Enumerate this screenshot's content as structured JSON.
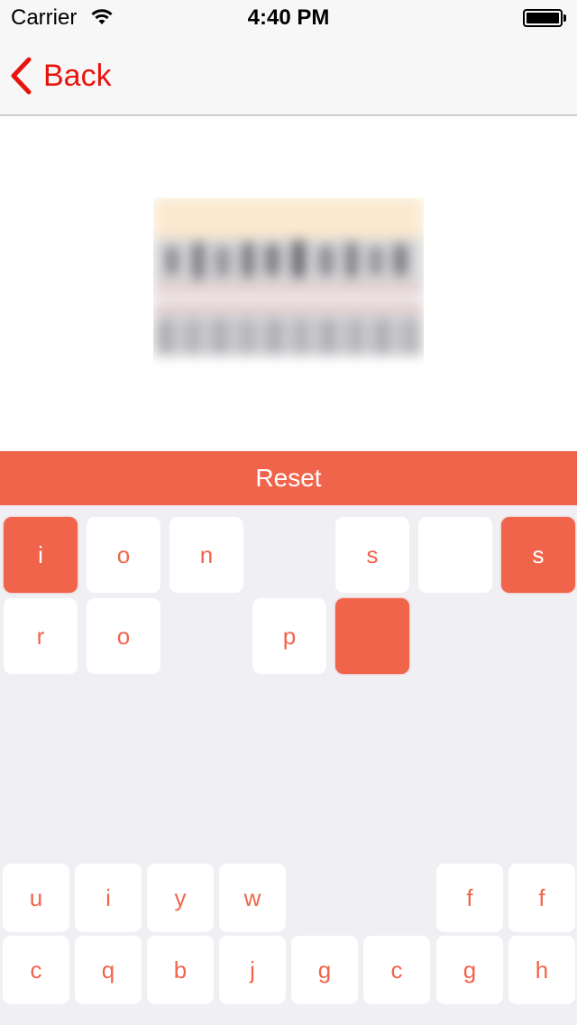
{
  "status_bar": {
    "carrier": "Carrier",
    "time": "4:40 PM"
  },
  "nav": {
    "back_label": "Back"
  },
  "reset": {
    "label": "Reset"
  },
  "answer_row1": [
    {
      "letter": "i",
      "state": "filled"
    },
    {
      "letter": "o",
      "state": "normal"
    },
    {
      "letter": "n",
      "state": "normal"
    },
    {
      "letter": "",
      "state": "gap"
    },
    {
      "letter": "s",
      "state": "normal"
    },
    {
      "letter": "",
      "state": "empty"
    },
    {
      "letter": "s",
      "state": "filled"
    }
  ],
  "answer_row2": [
    {
      "letter": "r",
      "state": "normal"
    },
    {
      "letter": "o",
      "state": "normal"
    },
    {
      "letter": "",
      "state": "gap"
    },
    {
      "letter": "p",
      "state": "normal"
    },
    {
      "letter": "",
      "state": "filled"
    }
  ],
  "keyboard_row1": [
    "u",
    "i",
    "y",
    "w",
    "",
    "",
    "f",
    "f"
  ],
  "keyboard_row2": [
    "c",
    "q",
    "b",
    "j",
    "g",
    "c",
    "g",
    "h"
  ],
  "colors": {
    "accent": "#f1644c",
    "back_red": "#e8140e",
    "background": "#efeff4"
  }
}
